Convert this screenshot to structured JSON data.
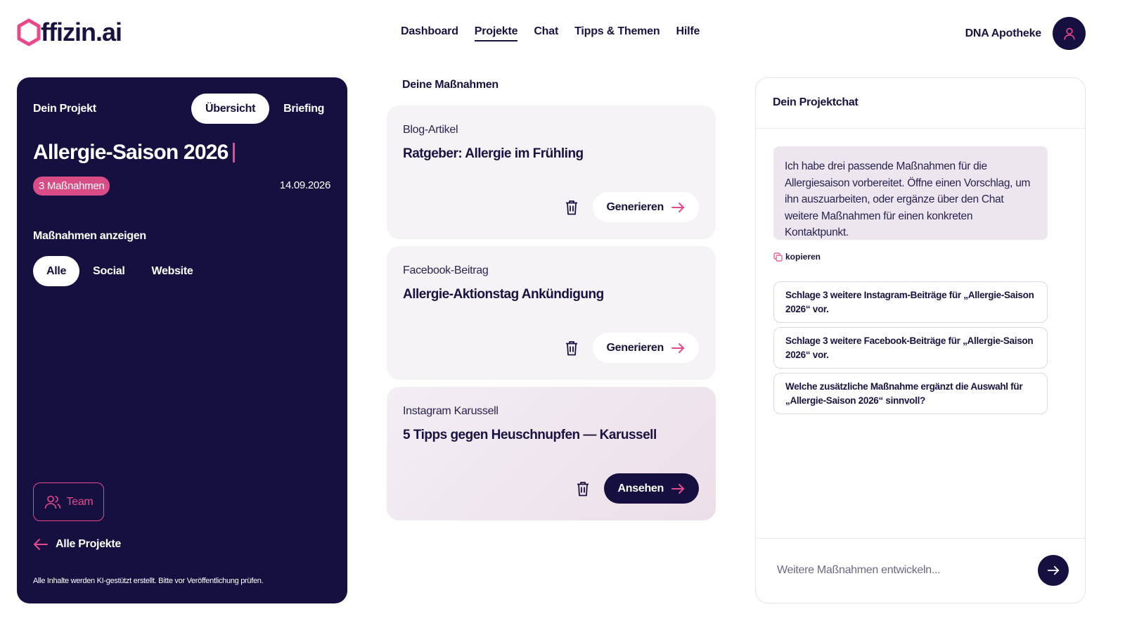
{
  "brand": {
    "name": "ffizin.ai",
    "accent": "#e8498a",
    "dark": "#15103f"
  },
  "nav": {
    "items": [
      {
        "label": "Dashboard",
        "active": false
      },
      {
        "label": "Projekte",
        "active": true
      },
      {
        "label": "Chat",
        "active": false
      },
      {
        "label": "Tipps & Themen",
        "active": false
      },
      {
        "label": "Hilfe",
        "active": false
      }
    ]
  },
  "account": {
    "name": "DNA Apotheke",
    "icon": "user-icon"
  },
  "project": {
    "label": "Dein Projekt",
    "tabs": [
      {
        "label": "Übersicht",
        "active": true
      },
      {
        "label": "Briefing",
        "active": false
      }
    ],
    "title": "Allergie-Saison 2026",
    "badge": "3 Maßnahmen",
    "date": "14.09.2026",
    "filter_label": "Maßnahmen anzeigen",
    "filters": [
      {
        "label": "Alle",
        "active": true
      },
      {
        "label": "Social",
        "active": false
      },
      {
        "label": "Website",
        "active": false
      }
    ],
    "team_label": "Team",
    "back_label": "Alle Projekte",
    "disclaimer": "Alle Inhalte werden KI-gestützt erstellt. Bitte vor Veröffentlichung prüfen."
  },
  "measures": {
    "heading": "Deine Maßnahmen",
    "items": [
      {
        "type": "Blog-Artikel",
        "title": "Ratgeber: Allergie im Frühling",
        "action": "Generieren"
      },
      {
        "type": "Facebook-Beitrag",
        "title": "Allergie-Aktionstag Ankündigung",
        "action": "Generieren"
      },
      {
        "type": "Instagram Karussell",
        "title": "5 Tipps gegen Heuschnupfen — Karussell",
        "action": "Ansehen"
      }
    ]
  },
  "chat": {
    "title": "Dein Projektchat",
    "message": "Ich habe drei passende Maßnahmen für die Allergiesaison vorbereitet. Öffne einen Vorschlag, um ihn auszuarbeiten, oder ergänze über den Chat weitere Maßnahmen für einen konkreten Kontaktpunkt.",
    "copy_label": "kopieren",
    "suggestions": [
      "Schlage 3 weitere Instagram-Beiträge für „Allergie-Saison 2026“ vor.",
      "Schlage 3 weitere Facebook-Beiträge für „Allergie-Saison 2026“ vor.",
      "Welche zusätzliche Maßnahme ergänzt die Auswahl für „Allergie-Saison 2026“ sinnvoll?"
    ],
    "input_placeholder": "Weitere Maßnahmen entwickeln..."
  }
}
